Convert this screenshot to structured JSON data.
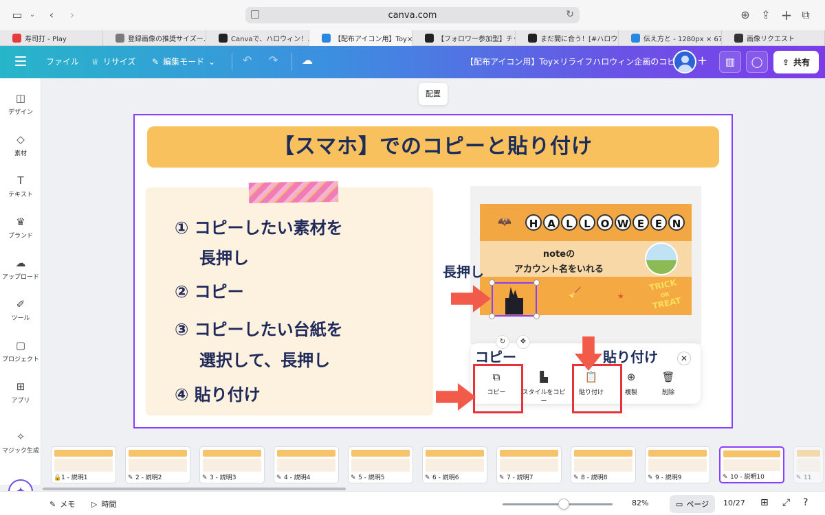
{
  "browser": {
    "url": "canva.com",
    "tabs": [
      {
        "label": "寿司打 - Play",
        "color": "#e53b3b",
        "active": false
      },
      {
        "label": "登録画像の推奨サイズー…",
        "color": "#7a7a7a",
        "active": false
      },
      {
        "label": "Canvaで、ハロウィン！…",
        "color": "#222222",
        "active": false
      },
      {
        "label": "【配布アイコン用】Toy×リ…",
        "color": "#2b88e0",
        "active": true
      },
      {
        "label": "【フォロワー参加型】チッ…",
        "color": "#222222",
        "active": false
      },
      {
        "label": "まだ間に合う！[#ハロウィ…",
        "color": "#222222",
        "active": false
      },
      {
        "label": "伝え方と - 1280px × 67…",
        "color": "#2b88e0",
        "active": false
      },
      {
        "label": "画像リクエスト",
        "color": "#333333",
        "active": false
      }
    ]
  },
  "header": {
    "file": "ファイル",
    "resize": "リサイズ",
    "edit_mode": "編集モード",
    "doc_title": "【配布アイコン用】Toy×リライフハロウィン企画のコピー",
    "share": "共有"
  },
  "sidebar": [
    {
      "label": "デザイン",
      "icon": "design-icon"
    },
    {
      "label": "素材",
      "icon": "elements-icon"
    },
    {
      "label": "テキスト",
      "icon": "text-icon"
    },
    {
      "label": "ブランド",
      "icon": "brand-icon"
    },
    {
      "label": "アップロード",
      "icon": "upload-icon"
    },
    {
      "label": "ツール",
      "icon": "tool-icon"
    },
    {
      "label": "プロジェクト",
      "icon": "project-icon"
    },
    {
      "label": "アプリ",
      "icon": "apps-icon"
    },
    {
      "label": "マジック生成",
      "icon": "magic-icon"
    }
  ],
  "canvas": {
    "arrange": "配置",
    "title": "【スマホ】でのコピーと貼り付け",
    "steps": [
      "① コピーしたい素材を",
      "長押し",
      "② コピー",
      "③ コピーしたい台紙を",
      "選択して、長押し",
      "④ 貼り付け"
    ],
    "halloween_letters": [
      "H",
      "A",
      "L",
      "L",
      "O",
      "W",
      "E",
      "E",
      "N"
    ],
    "note_line1": "noteの",
    "note_line2": "アカウント名をいれる",
    "trick": "TRICK",
    "or": "OR",
    "treat": "TREAT",
    "long_press": "長押し",
    "copy_label": "コピー",
    "paste_label": "貼り付け",
    "context_menu": [
      {
        "label": "コピー",
        "icon": "copy-icon"
      },
      {
        "label": "スタイルをコピー",
        "icon": "paint-roller-icon"
      },
      {
        "label": "貼り付け",
        "icon": "clipboard-icon"
      },
      {
        "label": "複製",
        "icon": "duplicate-icon"
      },
      {
        "label": "削除",
        "icon": "trash-icon"
      }
    ]
  },
  "thumbnails": [
    {
      "label": "1 - 説明1",
      "locked": true
    },
    {
      "label": "2 - 説明2",
      "locked": false
    },
    {
      "label": "3 - 説明3",
      "locked": false
    },
    {
      "label": "4 - 説明4",
      "locked": false
    },
    {
      "label": "5 - 説明5",
      "locked": false
    },
    {
      "label": "6 - 説明6",
      "locked": false
    },
    {
      "label": "7 - 説明7",
      "locked": false
    },
    {
      "label": "8 - 説明8",
      "locked": false
    },
    {
      "label": "9 - 説明9",
      "locked": false
    },
    {
      "label": "10 - 説明10",
      "locked": false,
      "current": true
    },
    {
      "label": "11",
      "locked": false
    }
  ],
  "bottom": {
    "notes": "メモ",
    "timer": "時間",
    "zoom": "82%",
    "pages_btn": "ページ",
    "page_count": "10/27"
  },
  "colors": {
    "accent": "#8b3dff",
    "title_band": "#f9c15d",
    "arrow": "#f25a4a",
    "highlight": "#e8323a"
  }
}
